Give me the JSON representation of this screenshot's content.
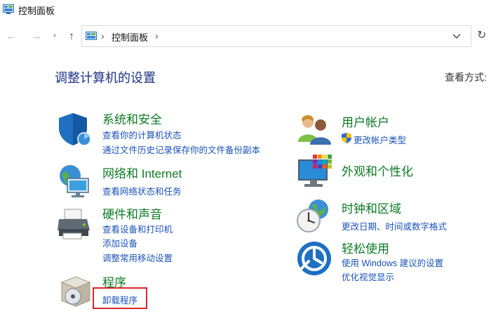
{
  "window": {
    "title": "控制面板",
    "icon": "control-panel-icon"
  },
  "nav": {
    "back_icon": "arrow-left-icon",
    "forward_icon": "arrow-right-icon",
    "recent_icon": "chevron-down-icon",
    "up_icon": "arrow-up-icon",
    "address": "控制面板",
    "dropdown_icon": "chevron-down-icon",
    "refresh_icon": "refresh-icon"
  },
  "main": {
    "title": "调整计算机的设置",
    "view_by_label": "查看方式:"
  },
  "categories": [
    {
      "title": "系统和安全",
      "icon": "shield-icon",
      "links": [
        "查看你的计算机状态",
        "通过文件历史记录保存你的文件备份副本"
      ]
    },
    {
      "title": "网络和 Internet",
      "icon": "network-globe-icon",
      "links": [
        "查看网络状态和任务"
      ]
    },
    {
      "title": "硬件和声音",
      "icon": "printer-icon",
      "links": [
        "查看设备和打印机",
        "添加设备",
        "调整常用移动设置"
      ]
    },
    {
      "title": "程序",
      "icon": "program-disc-icon",
      "links": [
        "卸载程序"
      ]
    },
    {
      "title": "用户帐户",
      "icon": "users-icon",
      "links": [
        "更改帐户类型"
      ]
    },
    {
      "title": "外观和个性化",
      "icon": "monitor-colors-icon",
      "links": []
    },
    {
      "title": "时钟和区域",
      "icon": "clock-globe-icon",
      "links": [
        "更改日期、时间或数字格式"
      ]
    },
    {
      "title": "轻松使用",
      "icon": "ease-of-access-icon",
      "links": [
        "使用 Windows 建议的设置",
        "优化视觉显示"
      ]
    }
  ],
  "colors": {
    "category_title": "#0c7a23",
    "link": "#1a52b8",
    "heading": "#1e3287",
    "highlight": "#d8282a"
  }
}
